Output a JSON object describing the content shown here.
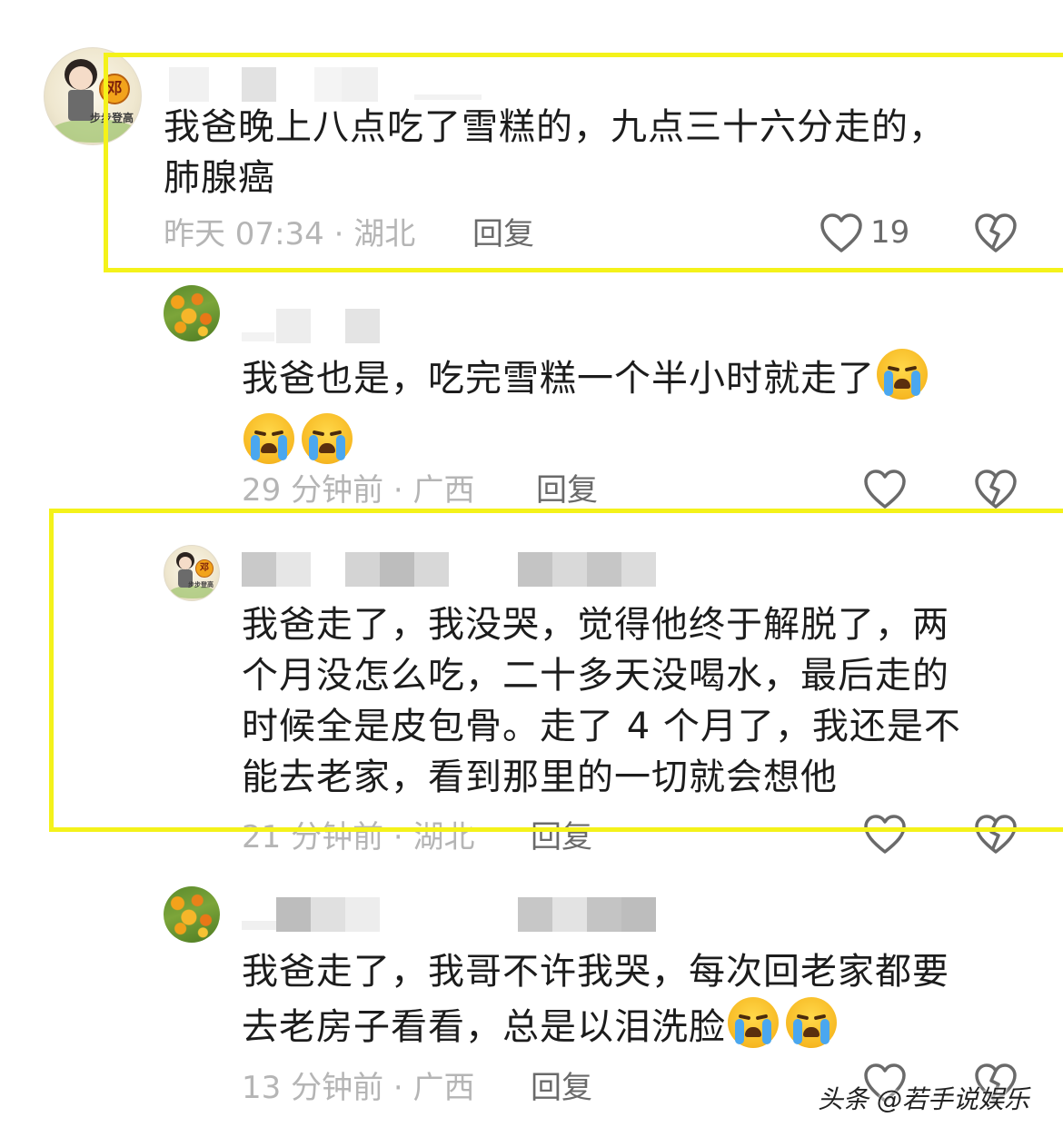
{
  "comments": [
    {
      "text": "我爸晚上八点吃了雪糕的，九点三十六分走的，肺腺癌",
      "line1": "我爸晚上八点吃了雪糕的，九点三十六分走的，",
      "line2": "肺腺癌",
      "meta": "昨天 07:34 · 湖北",
      "reply_label": "回复",
      "like_count": "19",
      "avatar": "girl-sticker-avatar"
    },
    {
      "line1": "我爸也是，吃完雪糕一个半小时就走了",
      "emoji": "loudly-crying-face",
      "meta": "29 分钟前 · 广西",
      "reply_label": "回复",
      "avatar": "flower-field-avatar"
    },
    {
      "line1": "我爸走了，我没哭，觉得他终于解脱了，两",
      "line2": "个月没怎么吃，二十多天没喝水，最后走的",
      "line3": "时候全是皮包骨。走了 4 个月了，我还是不",
      "line4": "能去老家，看到那里的一切就会想他",
      "meta": "21 分钟前 · 湖北",
      "reply_label": "回复",
      "avatar": "girl-sticker-avatar"
    },
    {
      "line1": "我爸走了，我哥不许我哭，每次回老家都要",
      "line2": "去老房子看看，总是以泪洗脸",
      "emoji": "loudly-crying-face",
      "meta": "13 分钟前 · 广西",
      "reply_label": "回复",
      "avatar": "flower-field-avatar"
    }
  ],
  "avatar_badge": "邓",
  "avatar_caption": "步步登高",
  "watermark": "头条 @若手说娱乐",
  "colors": {
    "highlight": "#f4f21a",
    "meta_text": "#b5b5b5",
    "reply_text": "#6a6a6a",
    "body_text": "#1c1c1c",
    "emoji_tear": "#4aa7ef"
  }
}
